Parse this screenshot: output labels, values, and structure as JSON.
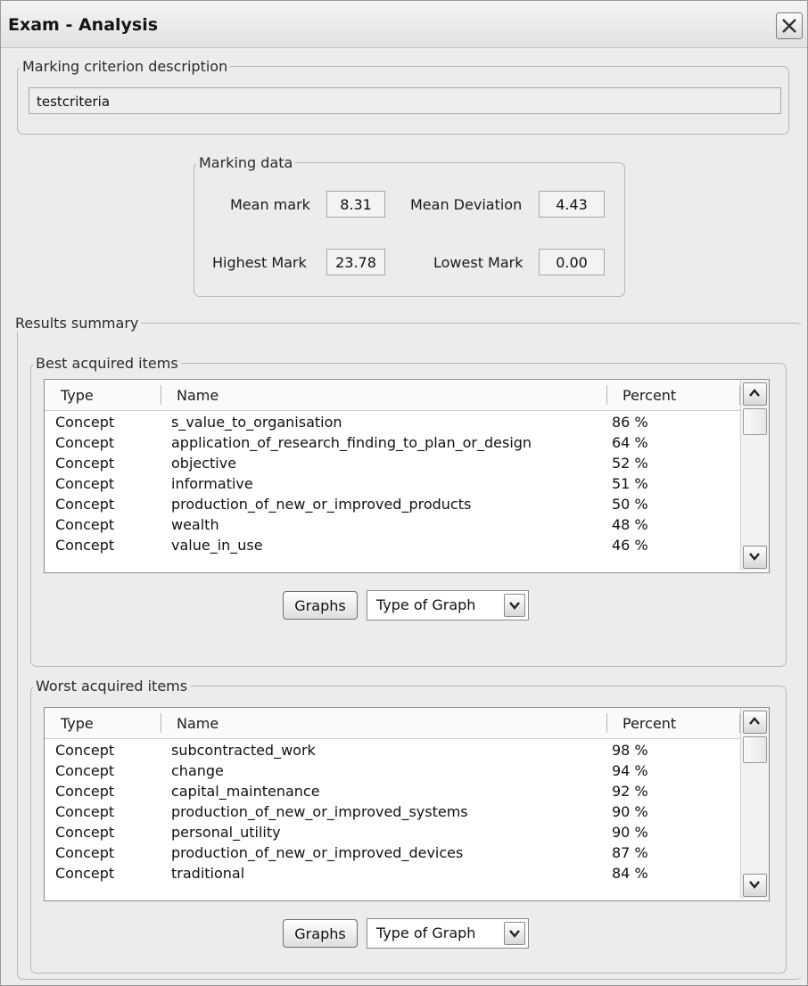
{
  "window": {
    "title": "Exam - Analysis"
  },
  "criterion": {
    "legend": "Marking criterion description",
    "value": "testcriteria"
  },
  "marking": {
    "legend": "Marking data",
    "mean_label": "Mean mark",
    "mean_value": "8.31",
    "deviation_label": "Mean Deviation",
    "deviation_value": "4.43",
    "highest_label": "Highest Mark",
    "highest_value": "23.78",
    "lowest_label": "Lowest Mark",
    "lowest_value": "0.00"
  },
  "results": {
    "legend": "Results summary",
    "best": {
      "legend": "Best acquired items",
      "headers": {
        "type": "Type",
        "name": "Name",
        "percent": "Percent"
      },
      "rows": [
        {
          "type": "Concept",
          "name": "s_value_to_organisation",
          "percent": "86 %"
        },
        {
          "type": "Concept",
          "name": "application_of_research_finding_to_plan_or_design",
          "percent": "64 %"
        },
        {
          "type": "Concept",
          "name": "objective",
          "percent": "52 %"
        },
        {
          "type": "Concept",
          "name": "informative",
          "percent": "51 %"
        },
        {
          "type": "Concept",
          "name": "production_of_new_or_improved_products",
          "percent": "50 %"
        },
        {
          "type": "Concept",
          "name": "wealth",
          "percent": "48 %"
        },
        {
          "type": "Concept",
          "name": "value_in_use",
          "percent": "46 %"
        }
      ],
      "graphs_label": "Graphs",
      "graph_type": "Type of Graph"
    },
    "worst": {
      "legend": "Worst acquired items",
      "headers": {
        "type": "Type",
        "name": "Name",
        "percent": "Percent"
      },
      "rows": [
        {
          "type": "Concept",
          "name": "subcontracted_work",
          "percent": "98 %"
        },
        {
          "type": "Concept",
          "name": "change",
          "percent": "94 %"
        },
        {
          "type": "Concept",
          "name": "capital_maintenance",
          "percent": "92 %"
        },
        {
          "type": "Concept",
          "name": "production_of_new_or_improved_systems",
          "percent": "90 %"
        },
        {
          "type": "Concept",
          "name": "personal_utility",
          "percent": "90 %"
        },
        {
          "type": "Concept",
          "name": "production_of_new_or_improved_devices",
          "percent": "87 %"
        },
        {
          "type": "Concept",
          "name": "traditional",
          "percent": "84 %"
        }
      ],
      "graphs_label": "Graphs",
      "graph_type": "Type of Graph"
    }
  }
}
